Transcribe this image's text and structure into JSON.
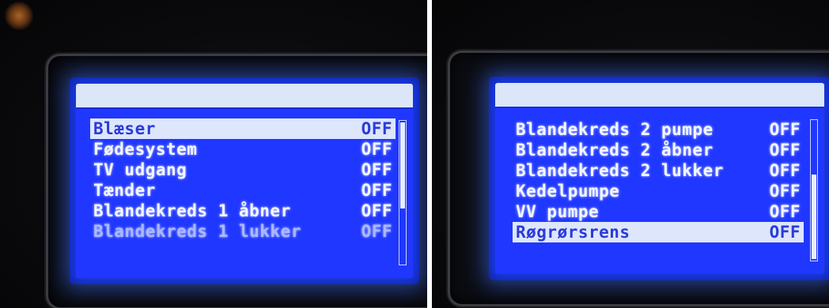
{
  "screens": {
    "left": {
      "items": [
        {
          "label": "Blæser",
          "value": "OFF"
        },
        {
          "label": "Fødesystem",
          "value": "OFF"
        },
        {
          "label": "TV udgang",
          "value": "OFF"
        },
        {
          "label": "Tænder",
          "value": "OFF"
        },
        {
          "label": "Blandekreds 1 åbner",
          "value": "OFF"
        },
        {
          "label": "Blandekreds 1 lukker",
          "value": "OFF"
        }
      ],
      "selected_index": 0
    },
    "right": {
      "items": [
        {
          "label": "Blandekreds 2 pumpe",
          "value": "OFF"
        },
        {
          "label": "Blandekreds 2 åbner",
          "value": "OFF"
        },
        {
          "label": "Blandekreds 2 lukker",
          "value": "OFF"
        },
        {
          "label": "Kedelpumpe",
          "value": "OFF"
        },
        {
          "label": "VV pumpe",
          "value": "OFF"
        },
        {
          "label": "Røgrørsrens",
          "value": "OFF"
        }
      ],
      "selected_index": 5
    }
  },
  "colors": {
    "lcd_background": "#2037ff",
    "lcd_text": "#f3f6ff",
    "selection_background": "#dde6fb",
    "selection_text": "#2b3bd8"
  }
}
